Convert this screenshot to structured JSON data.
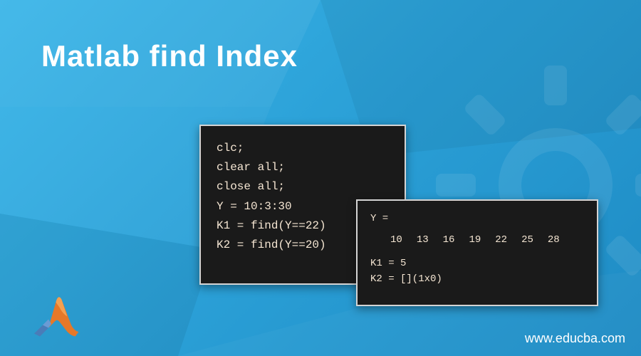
{
  "title": "Matlab find Index",
  "code1": {
    "line1": "clc;",
    "line2": "clear all;",
    "line3": "close all;",
    "line4": "Y = 10:3:30",
    "line5": "K1 = find(Y==22)",
    "line6": "K2 = find(Y==20)"
  },
  "code2": {
    "var_label": "Y =",
    "array": [
      "10",
      "13",
      "16",
      "19",
      "22",
      "25",
      "28"
    ],
    "result1": "K1 = 5",
    "result2": "K2 = [](1x0)"
  },
  "url": "www.educba.com",
  "colors": {
    "bg_gradient_start": "#3ab5e8",
    "bg_gradient_end": "#1e8bc4",
    "code_bg": "#1a1a1a",
    "code_text": "#f5e6d3",
    "title_color": "#ffffff"
  }
}
